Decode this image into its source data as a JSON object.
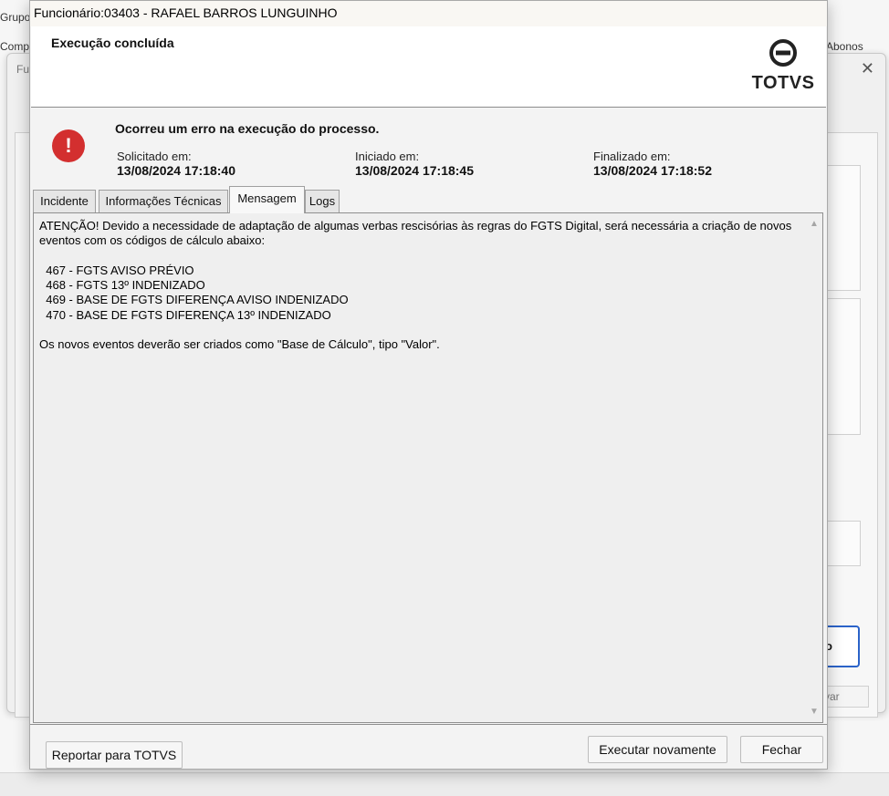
{
  "background": {
    "top_left_labels": [
      "Grupo",
      "Comp",
      "Fu"
    ],
    "right_label": "Abonos",
    "button_label": "o",
    "button2_label": "var"
  },
  "dialog": {
    "title": "Funcionário:03403 - RAFAEL BARROS LUNGUINHO",
    "banner_title": "Execução concluída",
    "logo_text": "TOTVS",
    "error_title": "Ocorreu um erro na execução do processo.",
    "requested": {
      "label": "Solicitado em:",
      "value": "13/08/2024 17:18:40"
    },
    "started": {
      "label": "Iniciado em:",
      "value": "13/08/2024 17:18:45"
    },
    "finished": {
      "label": "Finalizado em:",
      "value": "13/08/2024 17:18:52"
    },
    "tabs": [
      {
        "label": "Incidente"
      },
      {
        "label": "Informações Técnicas"
      },
      {
        "label": "Mensagem",
        "active": true
      },
      {
        "label": "Logs"
      }
    ],
    "message": "ATENÇÃO! Devido a necessidade de adaptação de algumas verbas rescisórias às regras do FGTS Digital, será necessária a criação de novos eventos com os códigos de cálculo abaixo:\n\n  467 - FGTS AVISO PRÉVIO\n  468 - FGTS 13º INDENIZADO\n  469 - BASE DE FGTS DIFERENÇA AVISO INDENIZADO\n  470 - BASE DE FGTS DIFERENÇA 13º INDENIZADO\n\nOs novos eventos deverão ser criados como \"Base de Cálculo\", tipo \"Valor\".",
    "buttons": {
      "report": "Reportar para TOTVS",
      "rerun": "Executar novamente",
      "close": "Fechar"
    }
  },
  "colors": {
    "error": "#d32f2f",
    "accent": "#2b63c9"
  }
}
